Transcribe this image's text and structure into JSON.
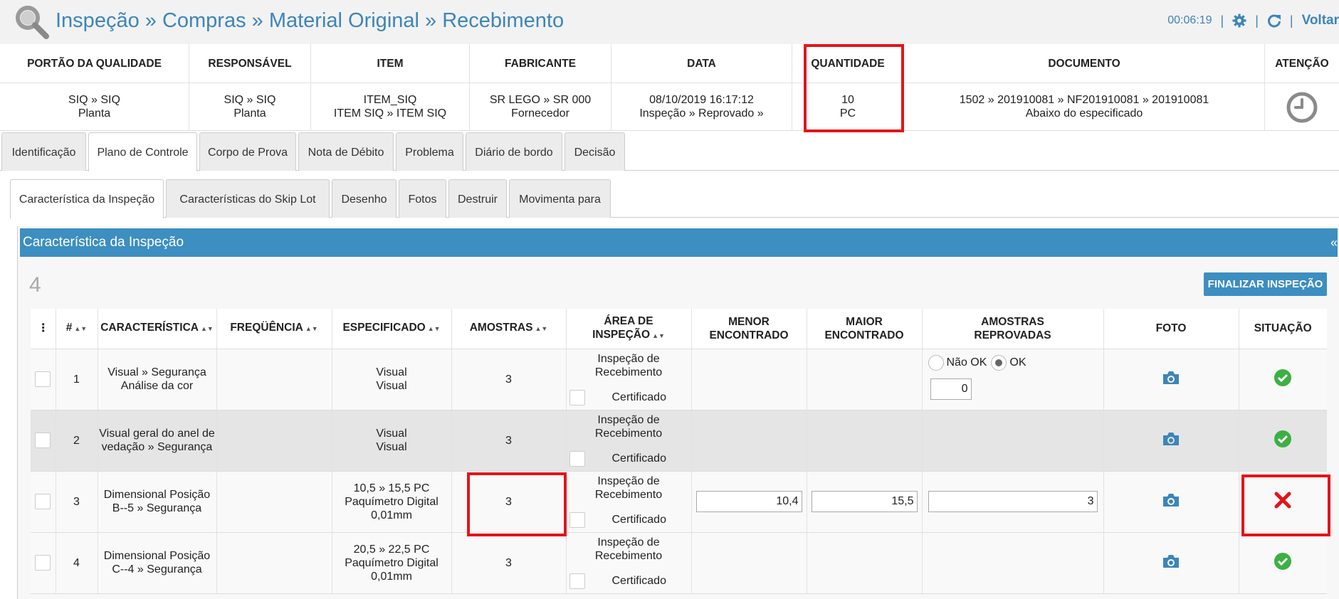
{
  "header": {
    "title": "Inspeção » Compras » Material Original » Recebimento",
    "timer": "00:06:19",
    "back_label": "Voltar"
  },
  "info": {
    "columns": [
      {
        "head": "PORTÃO DA QUALIDADE",
        "line1": "SIQ » SIQ",
        "line2": "Planta"
      },
      {
        "head": "RESPONSÁVEL",
        "line1": "SIQ » SIQ",
        "line2": "Planta"
      },
      {
        "head": "ITEM",
        "line1": "ITEM_SIQ",
        "line2": "ITEM SIQ » ITEM SIQ"
      },
      {
        "head": "FABRICANTE",
        "line1": "SR LEGO » SR 000",
        "line2": "Fornecedor"
      },
      {
        "head": "DATA",
        "line1": "08/10/2019 16:17:12",
        "line2": "Inspeção » Reprovado »"
      },
      {
        "head": "QUANTIDADE",
        "line1": "10",
        "line2": "PC"
      },
      {
        "head": "DOCUMENTO",
        "line1": "1502 » 201910081 » NF201910081 » 201910081",
        "line2": "Abaixo do especificado"
      },
      {
        "head": "ATENÇÃO"
      }
    ]
  },
  "tabs_main": [
    "Identificação",
    "Plano de Controle",
    "Corpo de Prova",
    "Nota de Débito",
    "Problema",
    "Diário de bordo",
    "Decisão"
  ],
  "tabs_sub": [
    "Característica da Inspeção",
    "Características do Skip Lot",
    "Desenho",
    "Fotos",
    "Destruir",
    "Movimenta para"
  ],
  "panel": {
    "title": "Característica da Inspeção",
    "collapse": "«",
    "count": "4",
    "finalize_label": "FINALIZAR INSPEÇÃO"
  },
  "table": {
    "headers": {
      "menu": "⋮",
      "num": "#",
      "caracteristica": "CARACTERÍSTICA",
      "frequencia": "FREQÜÊNCIA",
      "especificado": "ESPECIFICADO",
      "amostras": "AMOSTRAS",
      "area": "ÁREA DE INSPEÇÃO",
      "menor_1": "MENOR",
      "menor_2": "ENCONTRADO",
      "maior_1": "MAIOR",
      "maior_2": "ENCONTRADO",
      "reprov_1": "AMOSTRAS",
      "reprov_2": "REPROVADAS",
      "foto": "FOTO",
      "situacao": "SITUAÇÃO"
    },
    "area_line1": "Inspeção de",
    "area_line2": "Recebimento",
    "certificado": "Certificado",
    "nao_ok": "Não OK",
    "ok": "OK",
    "rows": [
      {
        "num": "1",
        "c1": "Visual » Segurança",
        "c2": "Análise da cor",
        "e1": "Visual",
        "e2": "Visual",
        "e3": "",
        "amostras": "3",
        "reprovadas": "0",
        "status": "ok"
      },
      {
        "num": "2",
        "c1": "Visual geral do anel de",
        "c2": "vedação » Segurança",
        "e1": "Visual",
        "e2": "Visual",
        "e3": "",
        "amostras": "3",
        "status": "ok"
      },
      {
        "num": "3",
        "c1": "Dimensional Posição",
        "c2": "B--5 » Segurança",
        "e1": "10,5 » 15,5 PC",
        "e2": "Paquímetro Digital",
        "e3": "0,01mm",
        "amostras": "3",
        "menor": "10,4",
        "maior": "15,5",
        "reprovadas": "3",
        "status": "fail"
      },
      {
        "num": "4",
        "c1": "Dimensional Posição",
        "c2": "C--4 » Segurança",
        "e1": "20,5 » 22,5 PC",
        "e2": "Paquímetro Digital",
        "e3": "0,01mm",
        "amostras": "3",
        "status": "ok"
      }
    ]
  },
  "colors": {
    "accent": "#3d85b8",
    "panel_header": "#3d8ec1",
    "ok_green": "#3cb043",
    "fail_red": "#e4141a",
    "highlight_box": "#e4141a"
  }
}
